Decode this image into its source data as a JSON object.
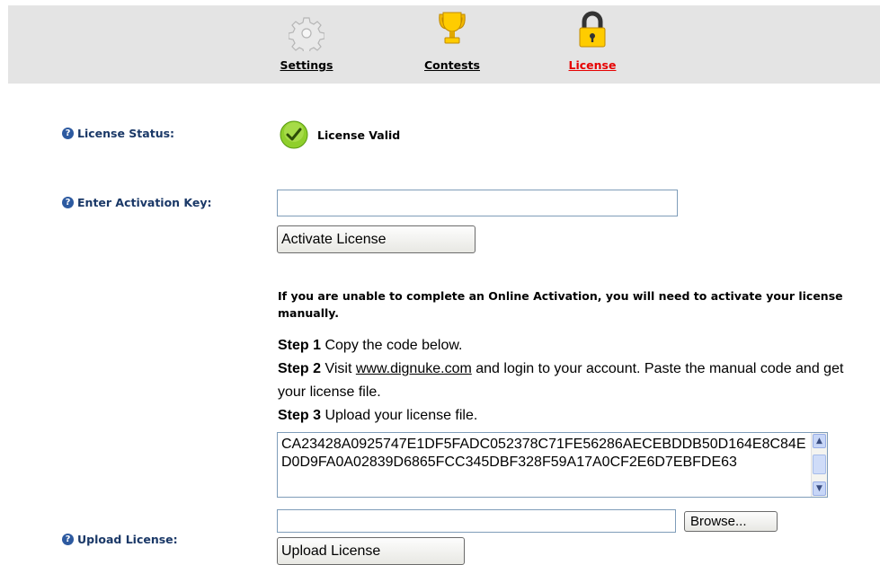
{
  "tabs": [
    {
      "label": "Settings",
      "icon": "gear-icon"
    },
    {
      "label": "Contests",
      "icon": "trophy-icon"
    },
    {
      "label": "License",
      "icon": "lock-icon",
      "active": true
    }
  ],
  "license_status": {
    "label": "License Status:",
    "value": "License Valid",
    "icon": "check-icon"
  },
  "activation": {
    "label": "Enter Activation Key:",
    "value": "",
    "placeholder": "",
    "button_label": "Activate License"
  },
  "manual": {
    "note": "If you are unable to complete an Online Activation, you will need to activate your license manually.",
    "step1_title": "Step 1",
    "step1_text": " Copy the code below.",
    "step2_title": "Step 2",
    "step2_pre": " Visit ",
    "step2_link": "www.dignuke.com",
    "step2_post": " and login to your account. Paste the manual code and get your license file.",
    "step3_title": "Step 3",
    "step3_text": " Upload your license file.",
    "code": "CA23428A0925747E1DF5FADC052378C71FE56286AECEBDDB50D164E8C84ED0D9FA0A02839D6865FCC345DBF328F59A17A0CF2E6D7EBFDE63"
  },
  "upload": {
    "label": "Upload License:",
    "file_value": "",
    "browse_label": "Browse...",
    "button_label": "Upload License"
  },
  "colors": {
    "label_blue": "#1a3867",
    "active_tab": "#e60000",
    "toolbar_bg": "#e4e4e4"
  }
}
